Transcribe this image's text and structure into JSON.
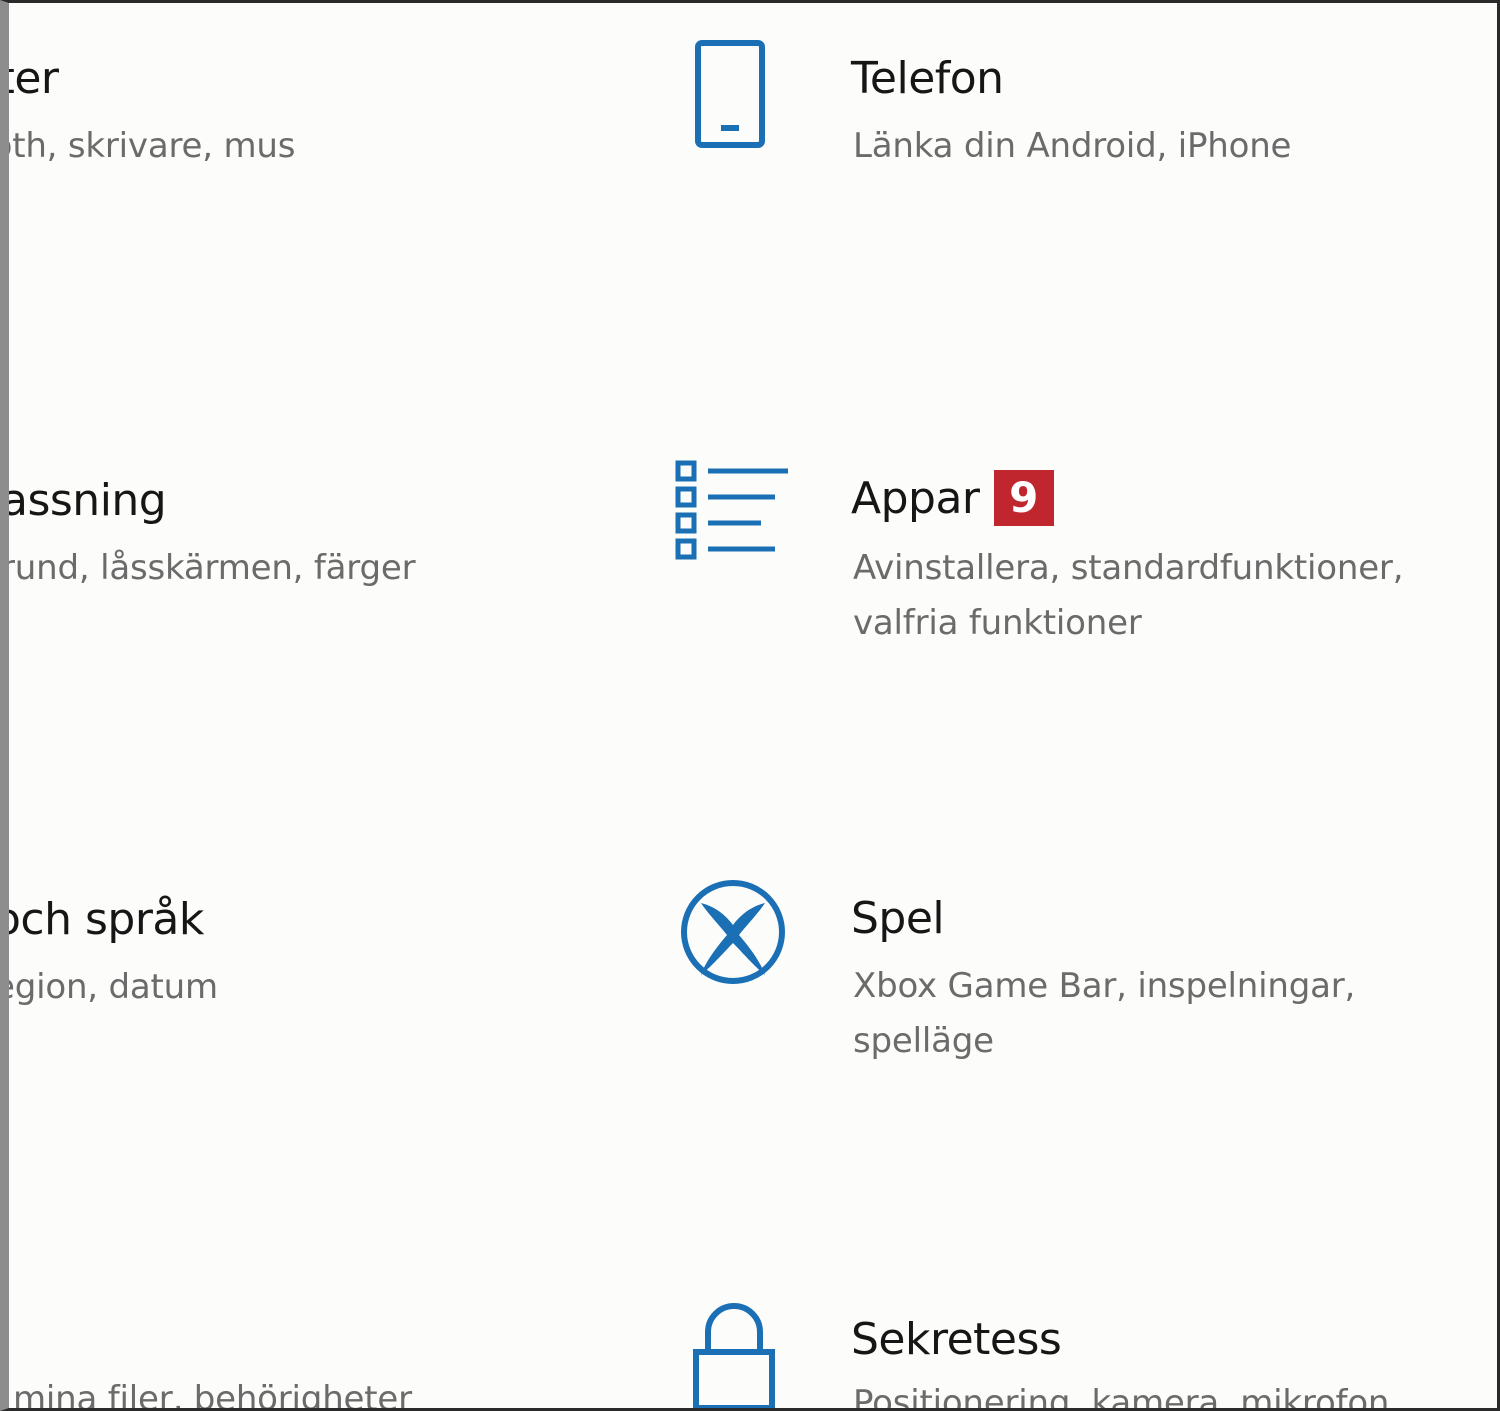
{
  "left_column": [
    {
      "title": "eter",
      "desc": "ooth, skrivare, mus"
    },
    {
      "title": "assning",
      "desc": "rund, låsskärmen, färger"
    },
    {
      "title": "och språk",
      "desc": "egion, datum"
    },
    {
      "title": "",
      "desc": "mina filer, behörigheter"
    }
  ],
  "right_column": [
    {
      "title": "Telefon",
      "desc": "Länka din Android, iPhone",
      "icon": "phone-icon"
    },
    {
      "title": "Appar",
      "badge": "9",
      "desc": "Avinstallera, standardfunktioner, valfria funktioner",
      "icon": "apps-list-icon"
    },
    {
      "title": "Spel",
      "desc": "Xbox Game Bar, inspelningar, spelläge",
      "icon": "xbox-icon"
    },
    {
      "title": "Sekretess",
      "desc": "Positionering, kamera, mikrofon",
      "icon": "lock-icon"
    }
  ],
  "colors": {
    "accent": "#1a6fb5",
    "badge": "#c0262d",
    "title_text": "#161616",
    "desc_text": "#6b6b6b"
  }
}
